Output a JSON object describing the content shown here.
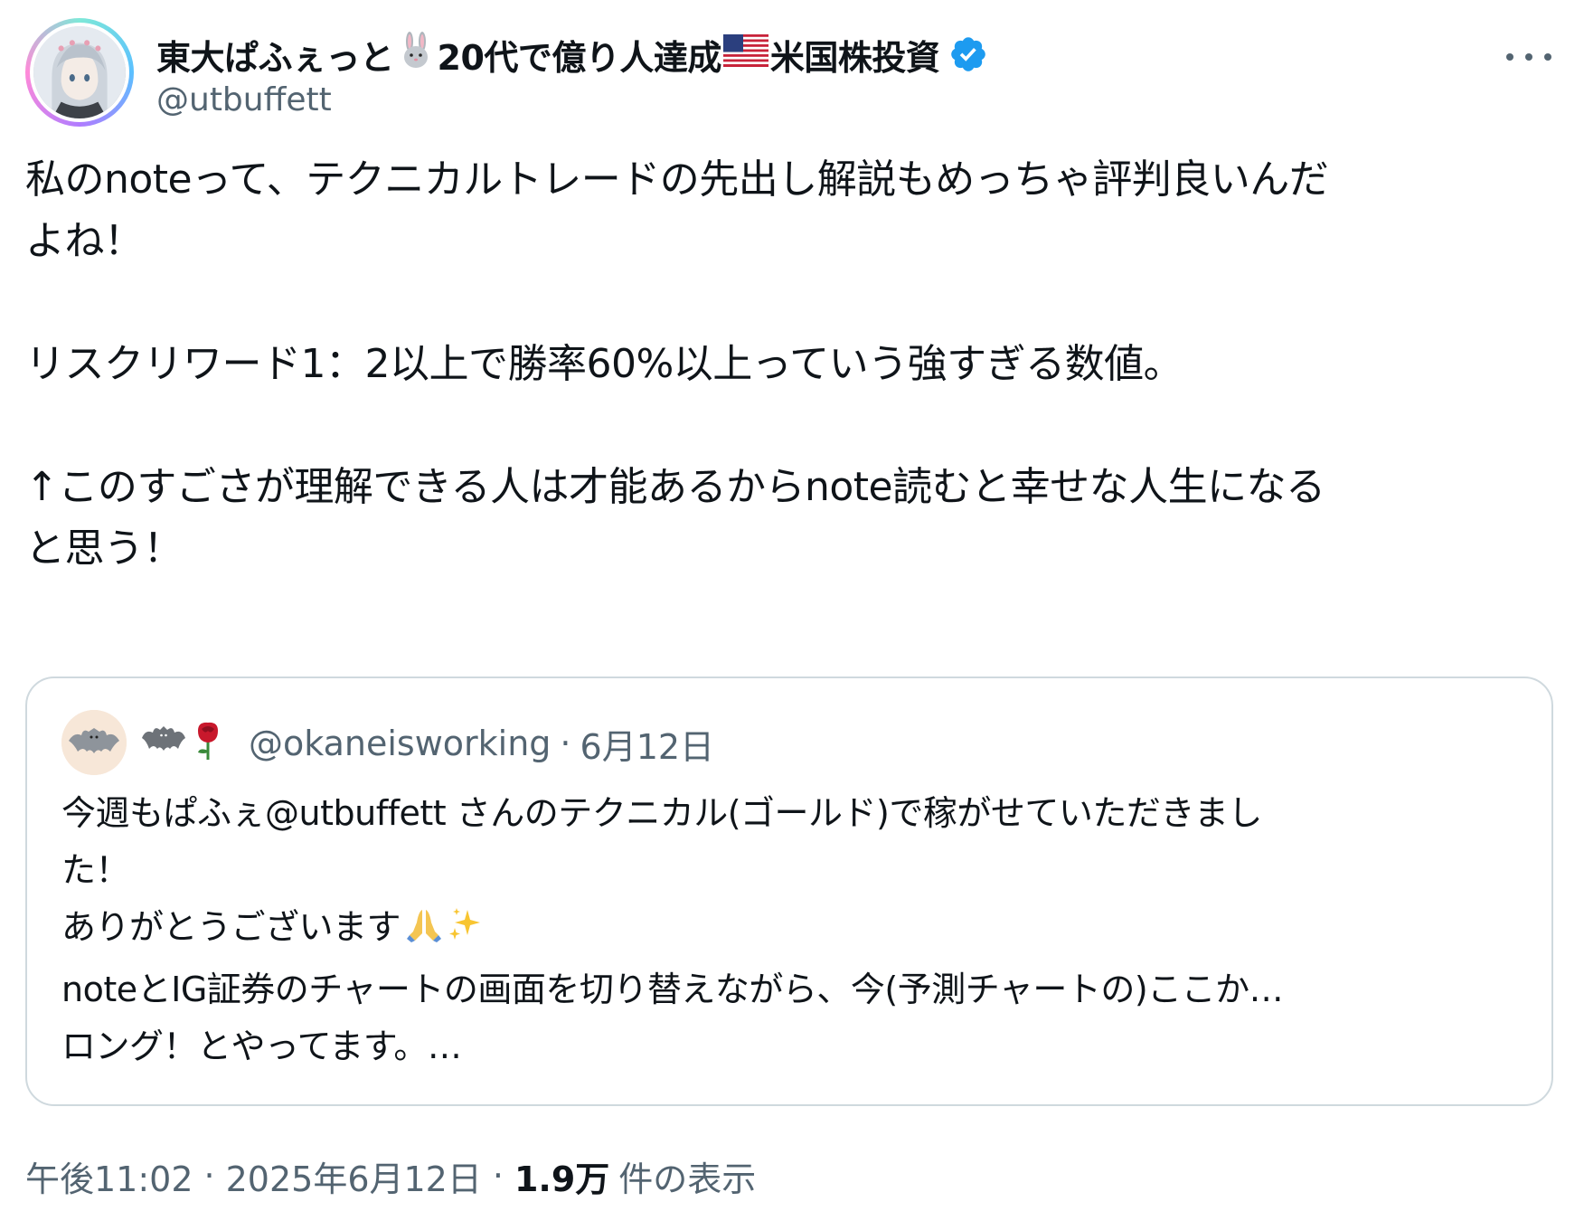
{
  "author": {
    "name_part1": "東大ぱふぇっと",
    "name_part2": "20代で億り人達成",
    "name_part3": "米国株投資",
    "handle": "@utbuffett",
    "rabbit_icon": "rabbit-emoji",
    "flag_icon": "us-flag-emoji",
    "verified": true,
    "verified_color": "#1d9bf0"
  },
  "tweet": {
    "text": "私のnoteって、テクニカルトレードの先出し解説もめっちゃ評判良いんだ\nよね！\n\nリスクリワード1：2以上で勝率60%以上っていう強すぎる数値。\n\n↑このすごさが理解できる人は才能あるからnote読むと幸せな人生になる\nと思う！"
  },
  "quoted_tweet": {
    "handle": "@okaneisworking",
    "dot": "·",
    "date": "6月12日",
    "display_emojis": [
      "bat-emoji",
      "rose-emoji"
    ],
    "text_line1": "今週もぱふぇ@utbuffett さんのテクニカル(ゴールド)で稼がせていただきまし\nた！\nありがとうございます",
    "text_line2": "\nnoteとIG証券のチャートの画面を切り替えながら、今(予測チャートの)ここか…\nロング！とやってます。…"
  },
  "meta": {
    "time": "午後11:02",
    "sep1": "·",
    "date": "2025年6月12日",
    "sep2": "·",
    "views_count": "1.9万",
    "views_label": "件の表示"
  },
  "colors": {
    "text": "#0f1419",
    "secondary": "#536471",
    "border": "#cfd9de"
  }
}
